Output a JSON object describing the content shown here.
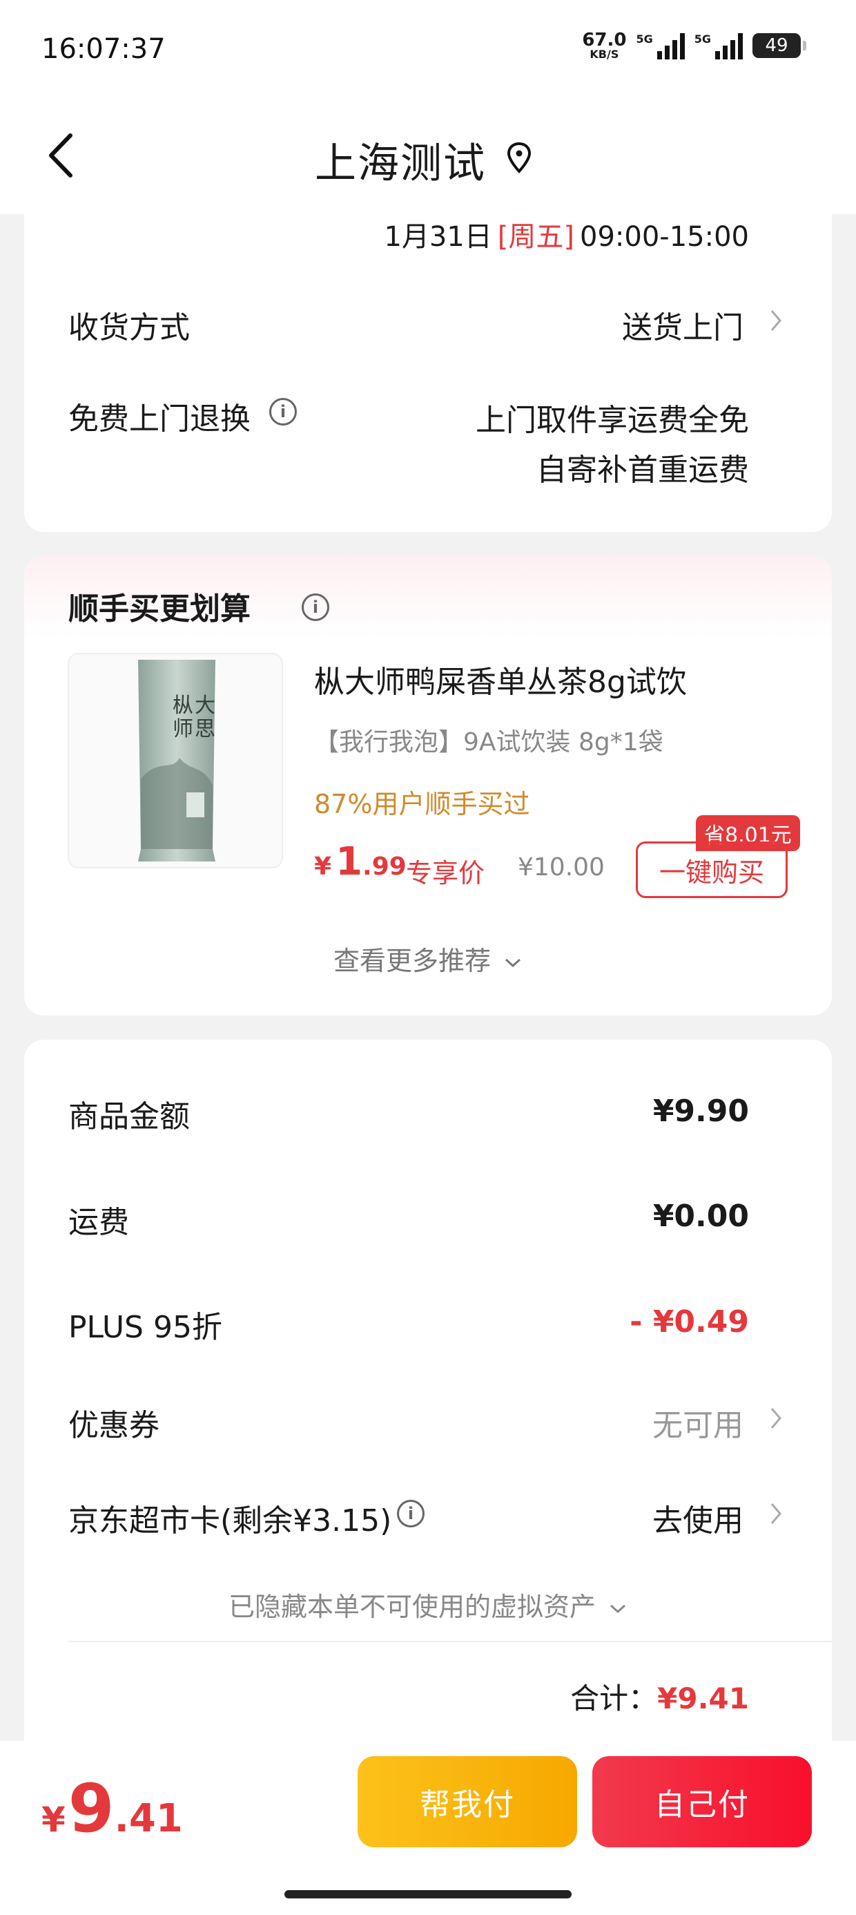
{
  "status_bar": {
    "time": "16:07:37",
    "net_speed": "67.0",
    "net_speed_unit": "KB/S",
    "net_type_1": "5G",
    "net_type_2": "5G",
    "battery": "49"
  },
  "header": {
    "title": "上海测试",
    "back_icon": "back-chevron-icon",
    "location_icon": "location-pin-icon"
  },
  "delivery": {
    "date": "1月31日",
    "weekday": "[周五]",
    "time_range": "09:00-15:00",
    "method_label": "收货方式",
    "method_value": "送货上门",
    "return_label": "免费上门退换",
    "return_value_line1": "上门取件享运费全免",
    "return_value_line2": "自寄补首重运费",
    "info_icon": "i"
  },
  "addon": {
    "title": "顺手买更划算",
    "info_icon": "i",
    "product_name": "枞大师鸭屎香单丛茶8g试饮",
    "product_desc": "【我行我泡】9A试饮装 8g*1袋",
    "product_stat": "87%用户顺手买过",
    "price_symbol": "¥",
    "price_int": "1",
    "price_dec": ".99",
    "price_tag": "专享价",
    "original_price": "¥10.00",
    "save_badge": "省8.01元",
    "buy_button": "一键购买",
    "more": "查看更多推荐",
    "package_text_1": "枞",
    "package_text_2": "大",
    "package_text_3": "师",
    "package_text_4": "思",
    "colors": {
      "accent": "#e4393c",
      "stat": "#d08a2e"
    }
  },
  "summary": {
    "rows": [
      {
        "label": "商品金额",
        "value": "¥9.90"
      },
      {
        "label": "运费",
        "value": "¥0.00"
      },
      {
        "label": "PLUS 95折",
        "value": "- ¥0.49"
      },
      {
        "label": "优惠券",
        "value": "无可用"
      },
      {
        "label": "京东超市卡(剩余¥3.15)",
        "value": "去使用"
      }
    ],
    "hidden_assets": "已隐藏本单不可使用的虚拟资产",
    "total_label": "合计：",
    "total_value": "¥9.41"
  },
  "bottom_bar": {
    "price_symbol": "¥",
    "price_int": "9",
    "price_dec": ".41",
    "help_pay": "帮我付",
    "self_pay": "自己付",
    "colors": {
      "help_pay": "#f7b500",
      "self_pay": "#f2213a"
    }
  }
}
